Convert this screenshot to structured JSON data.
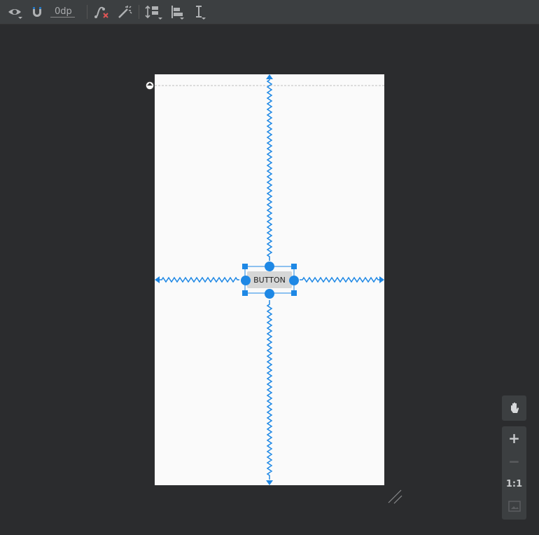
{
  "toolbar": {
    "view_options_icon": "eye-icon",
    "autoconnect_icon": "magnet-icon",
    "default_margin": "0dp",
    "clear_constraints_icon": "clear-constraints-icon",
    "infer_constraints_icon": "magic-wand-icon",
    "pack_icon": "pack-icon",
    "align_icon": "align-icon",
    "guidelines_icon": "guideline-icon"
  },
  "layout": {
    "widget_text": "BUTTON"
  },
  "zoom_panel": {
    "pan_icon": "hand-icon",
    "zoom_in": "+",
    "zoom_out": "−",
    "actual_size": "1:1",
    "zoom_to_fit_icon": "zoom-to-fit-icon"
  },
  "colors": {
    "background": "#2b2c2e",
    "toolbar": "#3c3f41",
    "screen": "#fafafa",
    "constraint": "#1e88e5",
    "button": "#d6d7d7"
  }
}
